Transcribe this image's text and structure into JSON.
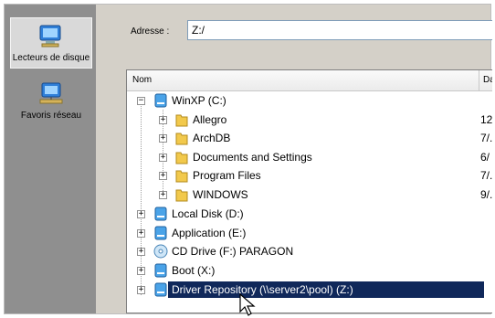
{
  "places": [
    {
      "label": "Lecteurs de disque",
      "icon": "computer-icon"
    },
    {
      "label": "Favoris réseau",
      "icon": "network-icon"
    }
  ],
  "address": {
    "label": "Adresse :",
    "value": "Z:/"
  },
  "columns": {
    "name": "Nom",
    "date": "Da"
  },
  "tree": [
    {
      "label": "WinXP (C:)",
      "icon": "drive-icon",
      "expanded": true
    },
    {
      "label": "Allegro",
      "icon": "folder-icon",
      "date": "12"
    },
    {
      "label": "ArchDB",
      "icon": "folder-icon",
      "date": "7/."
    },
    {
      "label": "Documents and Settings",
      "icon": "folder-icon",
      "date": "6/"
    },
    {
      "label": "Program Files",
      "icon": "folder-icon",
      "date": "7/."
    },
    {
      "label": "WINDOWS",
      "icon": "folder-icon",
      "date": "9/."
    },
    {
      "label": "Local Disk (D:)",
      "icon": "drive-icon"
    },
    {
      "label": "Application (E:)",
      "icon": "drive-icon"
    },
    {
      "label": "CD Drive (F:) PARAGON",
      "icon": "cd-drive-icon"
    },
    {
      "label": "Boot (X:)",
      "icon": "drive-icon"
    },
    {
      "label": "Driver Repository (\\\\server2\\pool) (Z:)",
      "icon": "network-drive-icon",
      "selected": true
    }
  ],
  "colors": {
    "selection": "#10285a",
    "places_bg": "#8f8f8f",
    "dialog_bg": "#d4d0c8"
  }
}
